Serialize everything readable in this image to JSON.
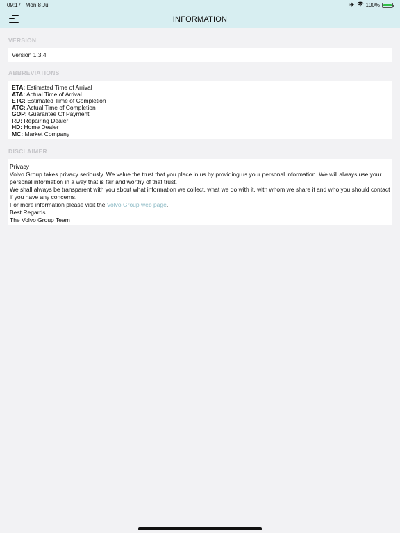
{
  "status_bar": {
    "time": "09:17",
    "date": "Mon 8 Jul",
    "battery": "100%"
  },
  "header": {
    "title": "INFORMATION"
  },
  "version": {
    "header": "VERSION",
    "value": "Version 1.3.4"
  },
  "abbreviations": {
    "header": "ABBREVIATIONS",
    "items": [
      {
        "key": "ETA:",
        "value": "Estimated Time of Arrival"
      },
      {
        "key": "ATA:",
        "value": "Actual Time of Arrival"
      },
      {
        "key": "ETC:",
        "value": "Estimated Time of Completion"
      },
      {
        "key": "ATC:",
        "value": "Actual Time of Completion"
      },
      {
        "key": "GOP:",
        "value": "Guarantee Of Payment"
      },
      {
        "key": "RD:",
        "value": "Repairing Dealer"
      },
      {
        "key": "HD:",
        "value": "Home Dealer"
      },
      {
        "key": "MC:",
        "value": "Market Company"
      }
    ]
  },
  "disclaimer": {
    "header": "DISCLAIMER",
    "title": "Privacy",
    "p1": "Volvo Group takes privacy seriously. We value the trust that you place in us by providing us your personal information. We will always use your personal information in a way that is fair and worthy of that trust.",
    "p2": "We shall always be transparent with you about what information we collect, what we do with it, with whom we share it and who you should contact if you have any concerns.",
    "more_prefix": "For more information please visit the ",
    "link_text": "Volvo Group web page",
    "more_suffix": ".",
    "regards": "Best Regards",
    "team": "The Volvo Group Team"
  },
  "colors": {
    "header_bg": "#d7eef1",
    "page_bg": "#f2f2f4",
    "link": "#8ab9c4",
    "section_header": "#c4c4c8"
  }
}
